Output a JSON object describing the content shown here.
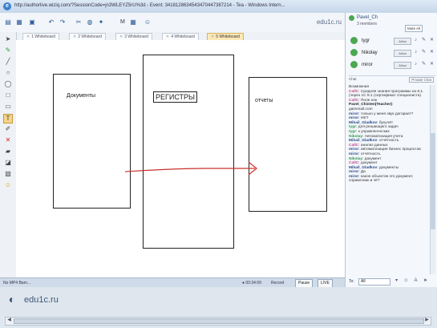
{
  "window": {
    "title": "http://authorlive.wiziq.com/?SessionCode=jn3WLEYZ5rU%3d - Event: 3418128634543470447387214 - Tea - Windows Intern..."
  },
  "toolbar": {
    "brand": "edu1c.ru",
    "m_label": "M"
  },
  "tabs": [
    {
      "label": "1 Whiteboard",
      "active": false
    },
    {
      "label": "2 Whiteboard",
      "active": false
    },
    {
      "label": "3 Whiteboard",
      "active": false
    },
    {
      "label": "4 Whiteboard",
      "active": false
    },
    {
      "label": "5 Whiteboard",
      "active": true
    }
  ],
  "canvas": {
    "doc_label": "Документы",
    "reg_label": "РЕГИСТРЫ",
    "rep_label": "отчеты"
  },
  "statusbar": {
    "left": "No MP4 Barn...",
    "timer": "00:34:09",
    "record": "Record",
    "pause": "Pause",
    "btn2": "LIVE"
  },
  "footer": {
    "brand": "edu1c.ru"
  },
  "right_panel": {
    "user": "Pavel_Ch",
    "members_count": "3 members",
    "btn_mute": "Mute All",
    "members": [
      {
        "name": "tygr",
        "bar": "Allow"
      },
      {
        "name": "Nikolay",
        "bar": "Allow"
      },
      {
        "name": "miror",
        "bar": "Allow"
      }
    ],
    "subheader": "Chat",
    "subheader_btn": "Private Chat",
    "chat": [
      {
        "who": "",
        "cls": "k",
        "text": "Возможная"
      },
      {
        "who": "CallC",
        "cls": "t",
        "text": ": Средняя знания программы на 8.1. (через 1С 8.1 (сертификат специалиста)"
      },
      {
        "who": "CallC",
        "cls": "t",
        "text": ": Поле нок"
      },
      {
        "who": "Pavel_Chisten(Teacher)",
        "cls": "k",
        "text": ":"
      },
      {
        "who": "",
        "cls": "k",
        "text": "gaimmail.com"
      },
      {
        "who": "miror",
        "cls": "b",
        "text": ": только у меня звук догорает?"
      },
      {
        "who": "miror",
        "cls": "b",
        "text": ": НЕТ"
      },
      {
        "who": "Mihail_Gladkov",
        "cls": "b",
        "text": ": бухучёт"
      },
      {
        "who": "tygr",
        "cls": "g",
        "text": ": для решающего задач"
      },
      {
        "who": "tygr",
        "cls": "g",
        "text": ": к управленческих"
      },
      {
        "who": "Nikolay",
        "cls": "g",
        "text": ": Автоматизация учета"
      },
      {
        "who": "Mihail_Gladkov",
        "cls": "b",
        "text": ": отчётность"
      },
      {
        "who": "CallC",
        "cls": "t",
        "text": ": анализ данных"
      },
      {
        "who": "miror",
        "cls": "b",
        "text": ": автоматизация бизнес процессов"
      },
      {
        "who": "miror",
        "cls": "b",
        "text": ": отчётность"
      },
      {
        "who": "Nikolay",
        "cls": "g",
        "text": ": документ"
      },
      {
        "who": "CallC",
        "cls": "t",
        "text": ": документ"
      },
      {
        "who": "Mihail_Gladkov",
        "cls": "b",
        "text": ": документы"
      },
      {
        "who": "miror",
        "cls": "b",
        "text": ": Да"
      },
      {
        "who": "miror",
        "cls": "b",
        "text": ": какое объектов это документ, справочник и чё?"
      }
    ],
    "to_label": "To:",
    "to_value": "All"
  }
}
